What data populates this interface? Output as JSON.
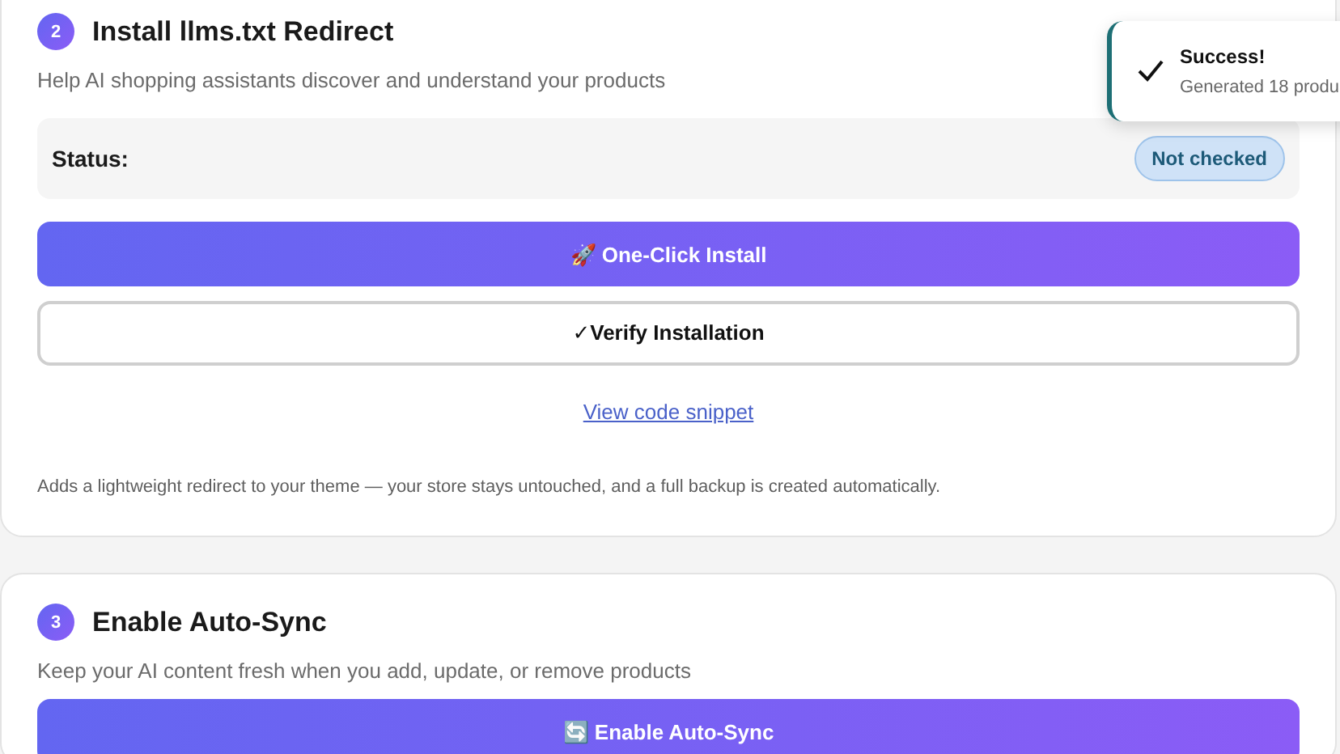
{
  "steps": [
    {
      "number": "2",
      "title": "Install llms.txt Redirect",
      "description": "Help AI shopping assistants discover and understand your products",
      "status": {
        "label": "Status:",
        "badge": "Not checked"
      },
      "buttons": [
        {
          "kind": "primary",
          "label": "🚀 One-Click Install"
        },
        {
          "kind": "outline",
          "label": "✓Verify Installation"
        }
      ],
      "link": "View code snippet",
      "note": "Adds a lightweight redirect to your theme — your store stays untouched, and a full backup is created automatically."
    },
    {
      "number": "3",
      "title": "Enable Auto-Sync",
      "description": "Keep your AI content fresh when you add, update, or remove products",
      "buttons": [
        {
          "kind": "primary",
          "label": "🔄 Enable Auto-Sync"
        }
      ]
    }
  ],
  "toast": {
    "title": "Success!",
    "message": "Generated 18 produ"
  }
}
